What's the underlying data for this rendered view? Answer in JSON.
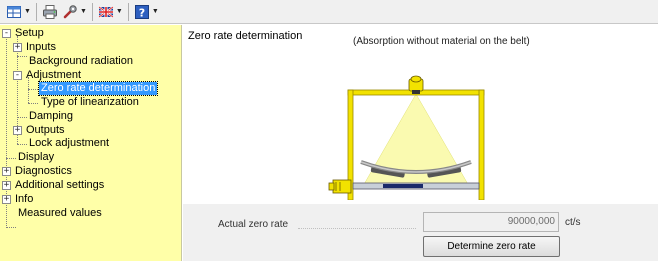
{
  "toolbar": {
    "items": [
      {
        "icon": "view-icon",
        "dropdown": true
      },
      {
        "icon": "printer-icon",
        "dropdown": false
      },
      {
        "icon": "settings-tool-icon",
        "dropdown": true
      },
      {
        "icon": "language-flag-icon",
        "dropdown": true
      },
      {
        "icon": "help-icon",
        "dropdown": true
      }
    ]
  },
  "tree": {
    "items": [
      {
        "label": "Setup",
        "level": 0,
        "expander": "-"
      },
      {
        "label": "Inputs",
        "level": 1,
        "expander": "+"
      },
      {
        "label": "Background radiation",
        "level": 1,
        "expander": ""
      },
      {
        "label": "Adjustment",
        "level": 1,
        "expander": "-"
      },
      {
        "label": "Zero rate determination",
        "level": 2,
        "expander": "",
        "selected": true
      },
      {
        "label": "Type of linearization",
        "level": 2,
        "expander": ""
      },
      {
        "label": "Damping",
        "level": 1,
        "expander": ""
      },
      {
        "label": "Outputs",
        "level": 1,
        "expander": "+"
      },
      {
        "label": "Lock adjustment",
        "level": 1,
        "expander": ""
      },
      {
        "label": "Display",
        "level": 0,
        "expander": ""
      },
      {
        "label": "Diagnostics",
        "level": 0,
        "expander": "+"
      },
      {
        "label": "Additional settings",
        "level": 0,
        "expander": "+"
      },
      {
        "label": "Info",
        "level": 0,
        "expander": "+"
      },
      {
        "label": "Measured values",
        "level": 0,
        "expander": ""
      }
    ]
  },
  "content": {
    "title": "Zero rate determination",
    "subtitle": "(Absorption without material on the belt)",
    "zero_rate_label": "Actual zero rate",
    "zero_rate_value": "90000,000",
    "zero_rate_unit": "ct/s",
    "determine_button": "Determine zero rate"
  },
  "colors": {
    "tree_background": "#ffffa8",
    "selection": "#3399ff",
    "frame_yellow": "#f2e200",
    "beam_yellow": "#fafab0"
  }
}
